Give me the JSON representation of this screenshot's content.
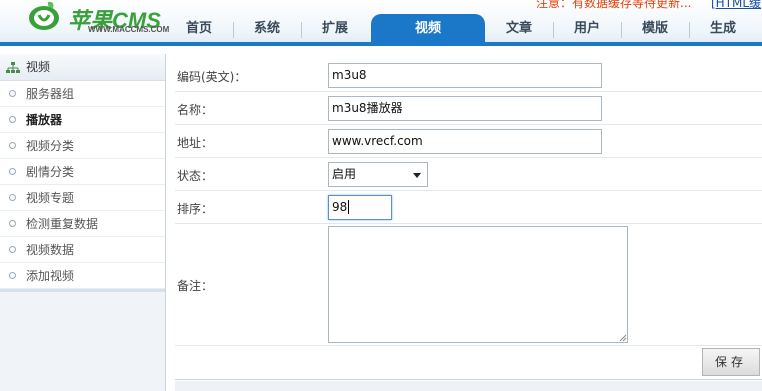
{
  "header": {
    "logo_text": "苹果CMS",
    "logo_url": "WWW.MACCMS.COM",
    "notice": "注意：有数据缓存等待更新...",
    "html_link": "[HTML缓"
  },
  "nav": {
    "items": [
      {
        "label": "首页",
        "active": false
      },
      {
        "label": "系统",
        "active": false
      },
      {
        "label": "扩展",
        "active": false
      },
      {
        "label": "视频",
        "active": true
      },
      {
        "label": "文章",
        "active": false
      },
      {
        "label": "用户",
        "active": false
      },
      {
        "label": "模版",
        "active": false
      },
      {
        "label": "生成",
        "active": false
      }
    ]
  },
  "sidebar": {
    "title": "视频",
    "items": [
      {
        "label": "服务器组"
      },
      {
        "label": "播放器",
        "active": true
      },
      {
        "label": "视频分类"
      },
      {
        "label": "剧情分类"
      },
      {
        "label": "视频专题"
      },
      {
        "label": "检测重复数据"
      },
      {
        "label": "视频数据"
      },
      {
        "label": "添加视频"
      }
    ]
  },
  "form": {
    "code_label": "编码(英文)：",
    "code_value": "m3u8",
    "name_label": "名称：",
    "name_value": "m3u8播放器",
    "address_label": "地址：",
    "address_value": "www.vrecf.com",
    "status_label": "状态：",
    "status_value": "启用",
    "sort_label": "排序：",
    "sort_value": "98",
    "remark_label": "备注：",
    "remark_value": "",
    "save_label": "保存"
  },
  "colors": {
    "nav_active": "#1b78c9",
    "logo_green": "#3aa13a",
    "notice_red": "#e8400c"
  }
}
